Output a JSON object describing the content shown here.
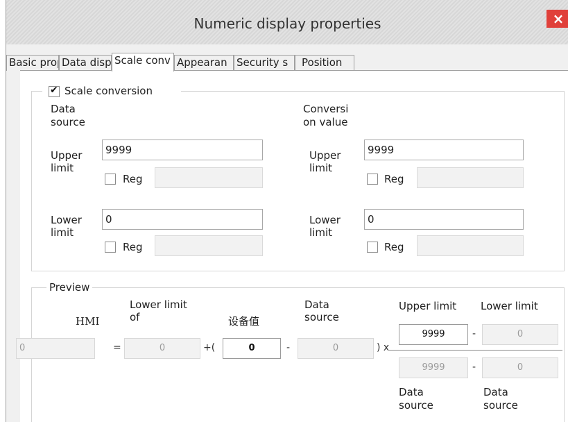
{
  "window": {
    "title": "Numeric display properties",
    "close_glyph": "×"
  },
  "tabs": [
    {
      "label": "Basic prop",
      "active": false
    },
    {
      "label": "Data displ",
      "active": false
    },
    {
      "label": "Scale conv",
      "active": true
    },
    {
      "label": "Appearan",
      "active": false
    },
    {
      "label": "Security s",
      "active": false
    },
    {
      "label": "Position",
      "active": false
    }
  ],
  "scale": {
    "checkbox_label": "Scale conversion",
    "checked": true,
    "data_source": {
      "header": [
        "Data",
        "source"
      ],
      "upper": {
        "label": [
          "Upper",
          "limit"
        ],
        "value": "9999",
        "reg_label": "Reg",
        "reg_checked": false,
        "reg_value": ""
      },
      "lower": {
        "label": [
          "Lower",
          "limit"
        ],
        "value": "0",
        "reg_label": "Reg",
        "reg_checked": false,
        "reg_value": ""
      }
    },
    "conversion_value": {
      "header": [
        "Conversi",
        "on value"
      ],
      "upper": {
        "label": [
          "Upper",
          "limit"
        ],
        "value": "9999",
        "reg_label": "Reg",
        "reg_checked": false,
        "reg_value": ""
      },
      "lower": {
        "label": [
          "Lower",
          "limit"
        ],
        "value": "0",
        "reg_label": "Reg",
        "reg_checked": false,
        "reg_value": ""
      }
    }
  },
  "preview": {
    "title": "Preview",
    "hmi_label": "HMI",
    "lower_limit_of_label": [
      "Lower limit",
      "of"
    ],
    "device_value_label": "设备值",
    "data_source_label": [
      "Data",
      "source"
    ],
    "upper_limit_label": "Upper limit",
    "lower_limit_label": "Lower limit",
    "bottom_data_source_1": [
      "Data",
      "source"
    ],
    "bottom_data_source_2": [
      "Data",
      "source"
    ],
    "hmi_value": "0",
    "lower_limit_value": "0",
    "device_value": "0",
    "data_source_value": "0",
    "num_upper": "9999",
    "num_lower": "0",
    "den_upper": "9999",
    "den_lower": "0",
    "sym_equals": "=",
    "sym_plus_paren": "+(",
    "sym_minus": "-",
    "sym_close_x": ") x"
  }
}
